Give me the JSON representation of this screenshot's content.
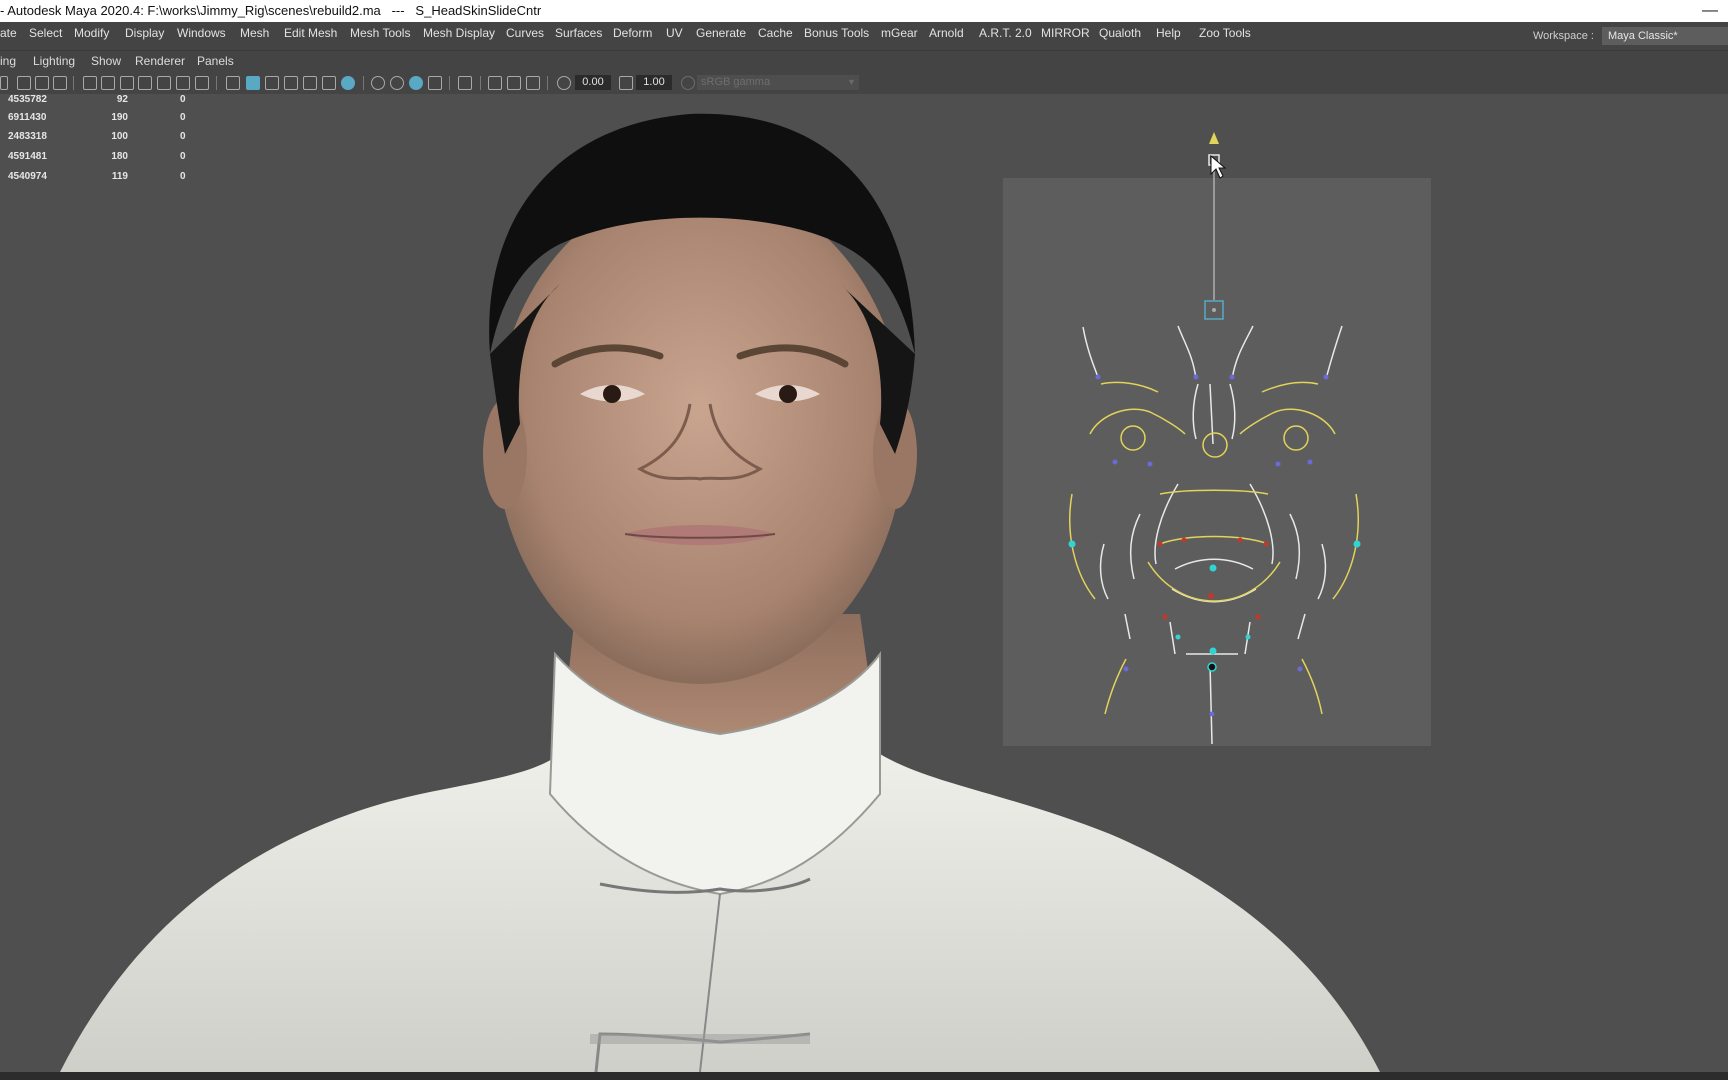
{
  "window": {
    "title": "- Autodesk Maya 2020.4: F:\\works\\Jimmy_Rig\\scenes\\rebuild2.ma   ---   S_HeadSkinSlideCntr",
    "close_glyph": "—"
  },
  "menubar": {
    "items": [
      "ate",
      "Select",
      "Modify",
      "Display",
      "Windows",
      "Mesh",
      "Edit Mesh",
      "Mesh Tools",
      "Mesh Display",
      "Curves",
      "Surfaces",
      "Deform",
      "UV",
      "Generate",
      "Cache",
      "Bonus Tools",
      "mGear",
      "Arnold",
      "A.R.T. 2.0",
      "MIRROR",
      "Qualoth",
      "Help",
      "Zoo Tools"
    ],
    "workspace_label": "Workspace :",
    "workspace_value": "Maya Classic*"
  },
  "panel_menu": {
    "items": [
      "ing",
      "Lighting",
      "Show",
      "Renderer",
      "Panels"
    ]
  },
  "panel_toolbar": {
    "exposure": "0.00",
    "gamma": "1.00",
    "color_space": "sRGB gamma"
  },
  "hud": {
    "rows": [
      {
        "a": "4535782",
        "b": "92",
        "c": "0"
      },
      {
        "a": "6911430",
        "b": "190",
        "c": "0"
      },
      {
        "a": "2483318",
        "b": "100",
        "c": "0"
      },
      {
        "a": "4591481",
        "b": "180",
        "c": "0"
      },
      {
        "a": "4540974",
        "b": "119",
        "c": "0"
      }
    ]
  },
  "colors": {
    "viewport_bg": "#4f4f4f",
    "ui_bg": "#444444",
    "accent": "#5aa9c4",
    "rig_yellow": "#e2d35a",
    "rig_white": "#e8e8e8",
    "rig_cyan": "#2fd5d5",
    "rig_red": "#c0392b",
    "rig_blue": "#6a6ad8"
  }
}
